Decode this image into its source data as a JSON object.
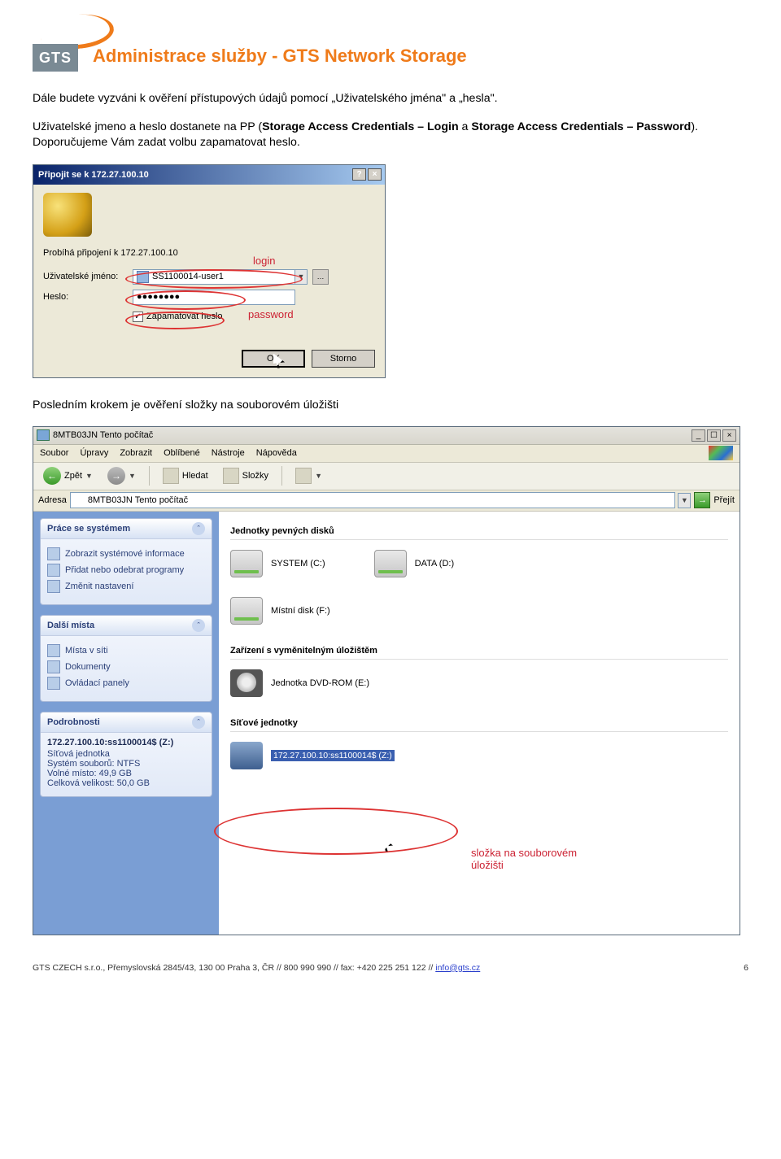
{
  "header": {
    "logo_text": "GTS",
    "title": "Administrace služby - GTS Network Storage"
  },
  "body": {
    "para1_a": "Dále budete vyzváni k ověření přístupových údajů pomocí „Uživatelského jména\" a „hesla\".",
    "para1_b": "Uživatelské jmeno a heslo dostanete na PP (",
    "para1_c": "Storage Access Credentials – Login",
    "para1_d": " a ",
    "para1_e": "Storage Access Credentials – Password",
    "para1_f": "). Doporučujeme Vám zadat volbu zapamatovat heslo.",
    "para2": "Posledním krokem je ověření složky na souborovém úložišti"
  },
  "dialog": {
    "title": "Připojit se k 172.27.100.10",
    "help_btn": "?",
    "close_btn": "×",
    "status": "Probíhá připojení k 172.27.100.10",
    "user_label": "Uživatelské jméno:",
    "user_value": "SS1100014-user1",
    "pass_label": "Heslo:",
    "pass_value": "●●●●●●●●",
    "remember": "Zapamatovat heslo",
    "check_mark": "✓",
    "ann_login": "login",
    "ann_password": "password",
    "ok": "OK",
    "cancel": "Storno"
  },
  "explorer": {
    "title": "8MTB03JN Tento počítač",
    "menu": [
      "Soubor",
      "Úpravy",
      "Zobrazit",
      "Oblíbené",
      "Nástroje",
      "Nápověda"
    ],
    "toolbar": {
      "back": "Zpět",
      "search": "Hledat",
      "folders": "Složky"
    },
    "addrbar": {
      "label": "Adresa",
      "value": "8MTB03JN Tento počítač",
      "go": "Přejít"
    },
    "sidebar": {
      "panel1": {
        "title": "Práce se systémem",
        "items": [
          "Zobrazit systémové informace",
          "Přidat nebo odebrat programy",
          "Změnit nastavení"
        ]
      },
      "panel2": {
        "title": "Další místa",
        "items": [
          "Místa v síti",
          "Dokumenty",
          "Ovládací panely"
        ]
      },
      "panel3": {
        "title": "Podrobnosti",
        "line1": "172.27.100.10:ss1100014$ (Z:)",
        "line2": "Síťová jednotka",
        "line3": "Systém souborů: NTFS",
        "line4": "Volné místo: 49,9 GB",
        "line5": "Celková velikost: 50,0 GB"
      }
    },
    "content": {
      "sec1": "Jednotky pevných disků",
      "drives": [
        "SYSTEM (C:)",
        "DATA (D:)",
        "Místní disk (F:)"
      ],
      "sec2": "Zařízení s vyměnitelným úložištěm",
      "dvd": "Jednotka DVD-ROM (E:)",
      "sec3": "Síťové jednotky",
      "netdrive": "172.27.100.10:ss1100014$ (Z:)",
      "ann_line1": "složka na souborovém",
      "ann_line2": "úložišti"
    }
  },
  "footer": {
    "text_a": "GTS CZECH s.r.o., Přemyslovská 2845/43, 130 00 Praha 3, ČR // 800 990 990  // fax: +420 225 251 122 // ",
    "email": "info@gts.cz",
    "page": "6"
  }
}
